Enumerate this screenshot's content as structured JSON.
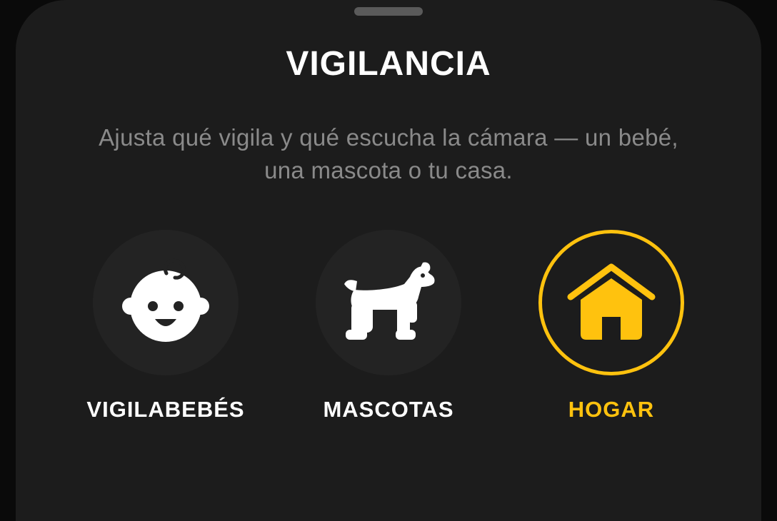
{
  "sheet": {
    "title": "VIGILANCIA",
    "description": "Ajusta qué vigila y qué escucha la cámara — un bebé, una mascota o tu casa."
  },
  "modes": [
    {
      "id": "baby",
      "label": "VIGILABEBÉS",
      "icon": "baby-face-icon",
      "selected": false
    },
    {
      "id": "pets",
      "label": "MASCOTAS",
      "icon": "dog-icon",
      "selected": false
    },
    {
      "id": "home",
      "label": "HOGAR",
      "icon": "house-icon",
      "selected": true
    }
  ],
  "colors": {
    "accent": "#ffc20e",
    "sheet_background": "#1c1c1c",
    "text_primary": "#ffffff",
    "text_secondary": "#8a8a8a"
  }
}
